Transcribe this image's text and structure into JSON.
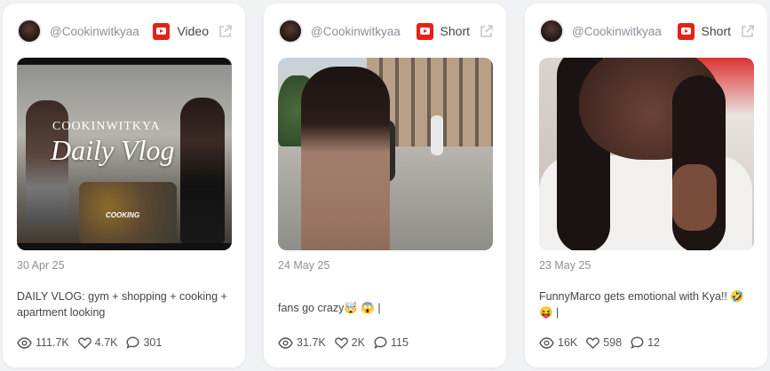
{
  "colors": {
    "youtube": "#e62117",
    "card_bg": "#ffffff",
    "page_bg": "#f1f2f5",
    "muted_text": "#8a8f98"
  },
  "cards": [
    {
      "handle": "@Cookinwitkyaa",
      "platform_icon": "youtube-icon",
      "type": "Video",
      "thumbnail": {
        "overlay_brand": "COOKINWITKYA",
        "overlay_title": "Daily Vlog",
        "overlay_sub": "COOKING"
      },
      "date": "30 Apr 25",
      "caption": "DAILY VLOG: gym + shopping + cooking + apartment looking",
      "stats": {
        "views": "111.7K",
        "likes": "4.7K",
        "comments": "301"
      }
    },
    {
      "handle": "@Cookinwitkyaa",
      "platform_icon": "youtube-icon",
      "type": "Short",
      "date": "24 May 25",
      "caption": "fans go crazy🤯 😱 |",
      "stats": {
        "views": "31.7K",
        "likes": "2K",
        "comments": "115"
      }
    },
    {
      "handle": "@Cookinwitkyaa",
      "platform_icon": "youtube-icon",
      "type": "Short",
      "date": "23 May 25",
      "caption": "FunnyMarco gets emotional with Kya!! 🤣 😝 |",
      "stats": {
        "views": "16K",
        "likes": "598",
        "comments": "12"
      }
    }
  ]
}
